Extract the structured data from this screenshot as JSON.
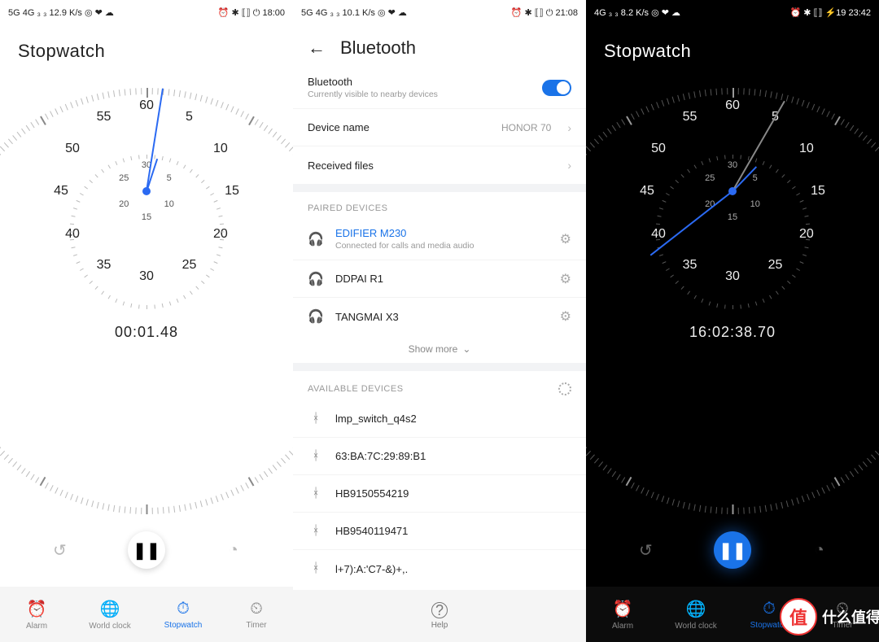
{
  "screen1": {
    "status": {
      "left": "5G 4G ₃ ₃ 12.9 K/s ◎ ❤ ☁",
      "right": "⏰ ✱ ⟦⟧ ⏻ 18:00",
      "time": "18:00"
    },
    "title": "Stopwatch",
    "elapsed": "00:01.48",
    "hand_main_deg": 9,
    "hand_sub_deg": 18,
    "dial": {
      "nums": [
        "60",
        "5",
        "10",
        "15",
        "20",
        "25",
        "30",
        "35",
        "40",
        "45",
        "50",
        "55"
      ],
      "sub": [
        "30",
        "5",
        "10",
        "15",
        "20",
        "25"
      ]
    },
    "nav": [
      {
        "label": "Alarm"
      },
      {
        "label": "World clock"
      },
      {
        "label": "Stopwatch",
        "active": true
      },
      {
        "label": "Timer"
      }
    ]
  },
  "screen2": {
    "status": {
      "left": "5G 4G ₃ ₃ 10.1 K/s ◎ ❤ ☁",
      "right": "⏰ ✱ ⟦⟧ ⏻ 21:08",
      "time": "21:08"
    },
    "title": "Bluetooth",
    "bt_label": "Bluetooth",
    "bt_sub": "Currently visible to nearby devices",
    "device_name_label": "Device name",
    "device_name_value": "HONOR 70",
    "received_label": "Received files",
    "paired_header": "PAIRED DEVICES",
    "paired": [
      {
        "name": "EDIFIER M230",
        "sub": "Connected for calls and media audio",
        "active": true
      },
      {
        "name": "DDPAI R1"
      },
      {
        "name": "TANGMAI X3"
      }
    ],
    "show_more": "Show more",
    "available_header": "AVAILABLE DEVICES",
    "available": [
      {
        "name": "lmp_switch_q4s2"
      },
      {
        "name": "63:BA:7C:29:89:B1"
      },
      {
        "name": "HB9150554219"
      },
      {
        "name": "HB9540119471"
      },
      {
        "name": "l+7):A:'C7-&)+,."
      }
    ],
    "help": "Help"
  },
  "screen3": {
    "status": {
      "left": "4G ₃ ₃ 8.2 K/s ◎ ❤ ☁",
      "right": "⏰ ✱ ⟦⟧ ⚡19 23:42",
      "time": "23:42"
    },
    "title": "Stopwatch",
    "elapsed": "16:02:38.70",
    "hand_main_deg": 232,
    "hand_sub_deg": 44,
    "hand_gray_deg": 30,
    "dial": {
      "nums": [
        "60",
        "5",
        "10",
        "15",
        "20",
        "25",
        "30",
        "35",
        "40",
        "45",
        "50",
        "55"
      ],
      "sub": [
        "30",
        "5",
        "10",
        "15",
        "20",
        "25"
      ]
    },
    "nav": [
      {
        "label": "Alarm"
      },
      {
        "label": "World clock"
      },
      {
        "label": "Stopwatch",
        "active": true
      },
      {
        "label": "Timer"
      }
    ]
  },
  "watermark": "什么值得买"
}
